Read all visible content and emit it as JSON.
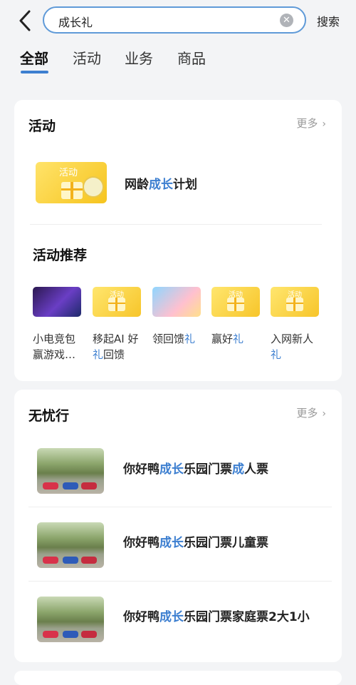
{
  "search": {
    "value": "成长礼",
    "button_label": "搜索"
  },
  "tabs": [
    {
      "label": "全部"
    },
    {
      "label": "活动"
    },
    {
      "label": "业务"
    },
    {
      "label": "商品"
    }
  ],
  "activity_section": {
    "title": "活动",
    "more_label": "更多",
    "main_item": {
      "thumb_tag": "活动",
      "title_pre": "网龄",
      "title_hl": "成长",
      "title_post": "计划"
    },
    "recommend_title": "活动推荐",
    "recommendations": [
      {
        "line1": "小电竞包",
        "line2": "赢游戏…"
      },
      {
        "thumb_tag": "活动",
        "line1": "移起AI 好",
        "line2_hl": "礼",
        "line2": "回馈"
      },
      {
        "line1_pre": "领回馈",
        "line1_hl": "礼"
      },
      {
        "thumb_tag": "活动",
        "line1_pre": "赢好",
        "line1_hl": "礼"
      },
      {
        "thumb_tag": "活动",
        "line1": "入网新人",
        "line2_hl": "礼"
      }
    ]
  },
  "travel_section": {
    "title": "无忧行",
    "more_label": "更多",
    "items": [
      {
        "pre": "你好鸭",
        "hl": "成长",
        "mid": "乐园门票",
        "hl2": "成",
        "post": "人票"
      },
      {
        "pre": "你好鸭",
        "hl": "成长",
        "mid": "乐园门票儿童票",
        "hl2": "",
        "post": ""
      },
      {
        "pre": "你好鸭",
        "hl": "成长",
        "mid": "乐园门票家庭票2大1小",
        "hl2": "",
        "post": ""
      }
    ]
  },
  "colors": {
    "accent": "#3d7fd0",
    "background": "#f3f4f6"
  }
}
